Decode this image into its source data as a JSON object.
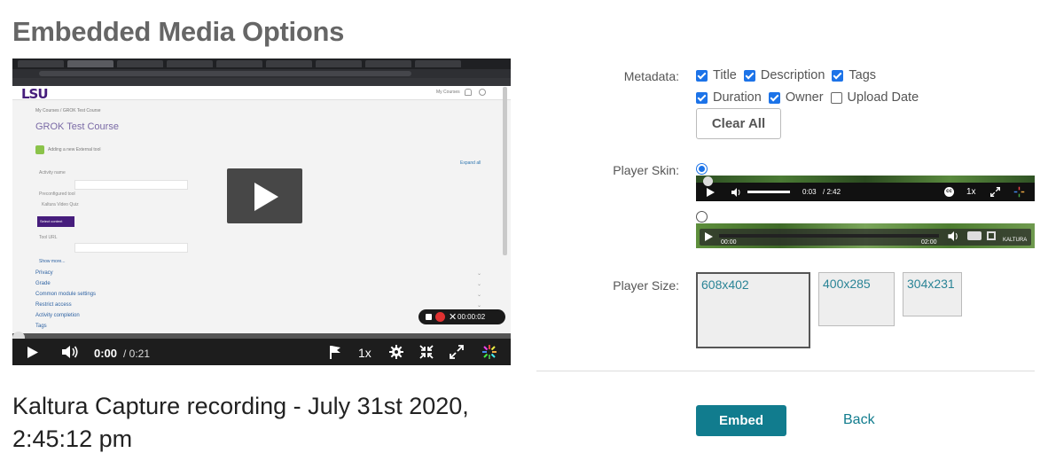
{
  "page": {
    "title": "Embedded Media Options"
  },
  "player": {
    "current_time": "0:00",
    "duration": "/ 0:21",
    "speed": "1x",
    "progress": 0,
    "screenshot": {
      "logo": "LSU",
      "my_courses": "My Courses",
      "breadcrumb": "My Courses / GROK Test Course",
      "course_title": "GROK Test Course",
      "adding_tool": "Adding a new External tool",
      "expand_all": "Expand all",
      "activity_name": "Activity name",
      "preconfigured_tool": "Preconfigured tool",
      "preconfigured_value": "Kaltura Video Quiz",
      "select_button": "Select content",
      "tool_url": "Tool URL",
      "show_more": "Show more...",
      "sections": [
        "Privacy",
        "Grade",
        "Common module settings",
        "Restrict access",
        "Activity completion",
        "Tags"
      ],
      "recording_time": "00:00:02"
    }
  },
  "video_title": "Kaltura Capture recording - July 31st 2020, 2:45:12 pm",
  "metadata": {
    "label": "Metadata:",
    "options": [
      {
        "label": "Title",
        "checked": true
      },
      {
        "label": "Description",
        "checked": true
      },
      {
        "label": "Tags",
        "checked": true
      },
      {
        "label": "Duration",
        "checked": true
      },
      {
        "label": "Owner",
        "checked": true
      },
      {
        "label": "Upload Date",
        "checked": false
      }
    ],
    "clear_all": "Clear All"
  },
  "player_skin": {
    "label": "Player Skin:",
    "selected": 0,
    "skin1": {
      "time": "0:03",
      "duration": "/ 2:42",
      "speed": "1x"
    },
    "skin2": {
      "start": "00:00",
      "end": "02:00",
      "brand": "KALTURA"
    }
  },
  "player_size": {
    "label": "Player Size:",
    "options": [
      "608x402",
      "400x285",
      "304x231"
    ],
    "selected": "608x402"
  },
  "actions": {
    "embed": "Embed",
    "back": "Back"
  },
  "colors": {
    "accent": "#117c8e",
    "checkbox": "#1c73e8",
    "title": "#666666"
  }
}
